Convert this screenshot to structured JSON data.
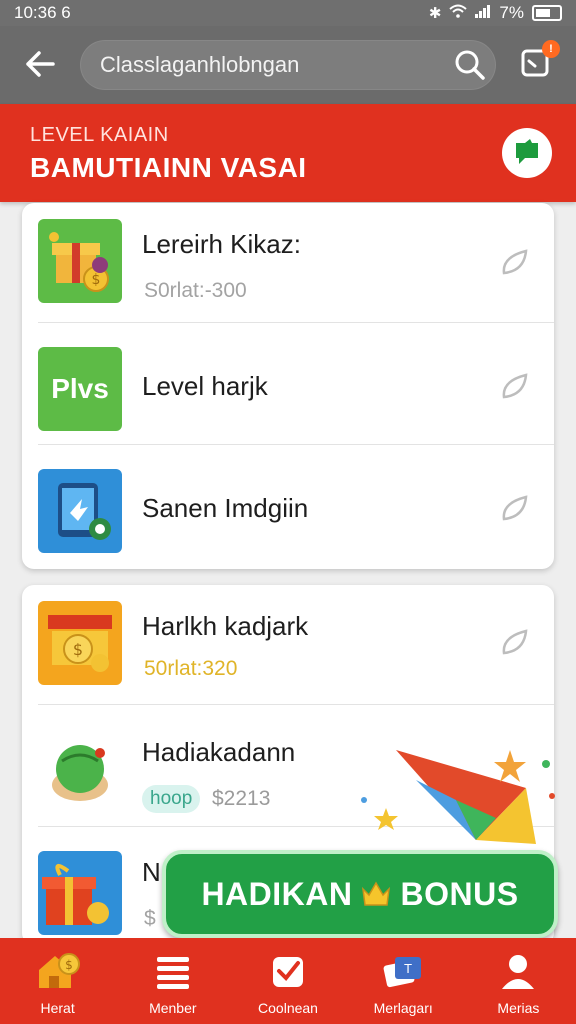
{
  "status": {
    "time": "10:36",
    "glyph": "6",
    "battery": "7%"
  },
  "search": {
    "value": "Classlaganhlobngan"
  },
  "cart": {
    "badge": "!"
  },
  "banner": {
    "subtitle": "LEVEL KAIAIN",
    "title": "BAMUTIAINN VASAI"
  },
  "card1": [
    {
      "title": "Lereirh Kikaz:",
      "sub": "S0rlat:-300",
      "thumb": "gift-box-icon"
    },
    {
      "title": "Level harjk",
      "sub": "",
      "thumb": "plus-badge-icon",
      "thumb_text": "Plvs"
    },
    {
      "title": "Sanen Imdgiin",
      "sub": "",
      "thumb": "tablet-icon"
    }
  ],
  "card2": [
    {
      "title": "Harlkh kadjark",
      "sub": "50rlat:320",
      "thumb": "treasure-icon"
    },
    {
      "title": "Hadiakadann",
      "chip": "hoop",
      "price": "$2213",
      "thumb": "melon-bowl-icon"
    },
    {
      "title": "N",
      "sub": "$",
      "thumb": "gift-stack-icon"
    }
  ],
  "bonus": {
    "left": "HADIKAN",
    "right": "BONUS"
  },
  "tabs": [
    {
      "label": "Herat",
      "icon": "home-coin-icon"
    },
    {
      "label": "Menber",
      "icon": "menu-icon"
    },
    {
      "label": "Coolnean",
      "icon": "check-icon"
    },
    {
      "label": "Merlagarı",
      "icon": "tickets-icon"
    },
    {
      "label": "Merias",
      "icon": "user-icon"
    }
  ],
  "colors": {
    "primary": "#e0311f",
    "appbar": "#6b6b6b",
    "bonus": "#22a046"
  }
}
